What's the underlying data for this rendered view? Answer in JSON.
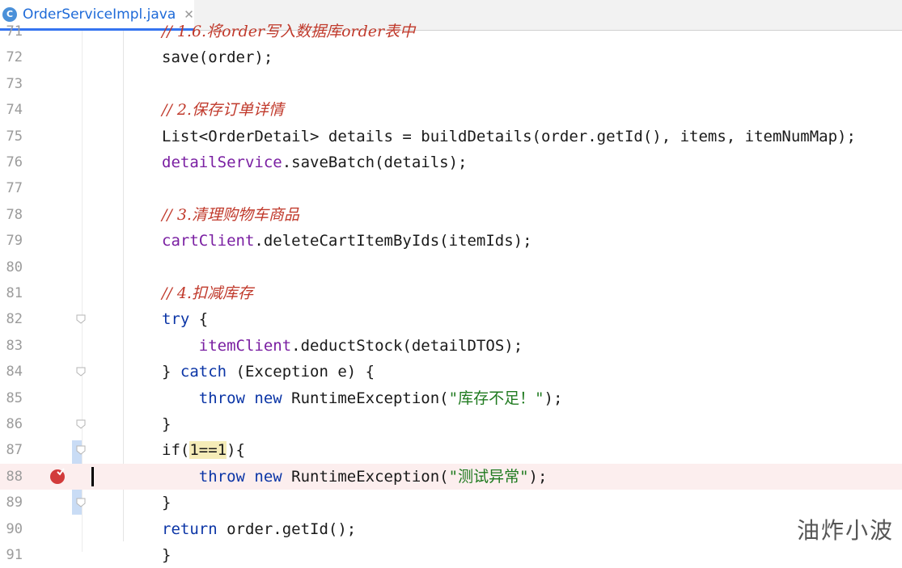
{
  "tab": {
    "icon_letter": "C",
    "title": "OrderServiceImpl.java",
    "close": "✕"
  },
  "lines": [
    {
      "num": "71",
      "parts": [
        {
          "t": "// 1.6.将order写入数据库order表中",
          "c": "cmt-red"
        }
      ]
    },
    {
      "num": "72",
      "parts": [
        {
          "t": "save(order);",
          "c": ""
        }
      ]
    },
    {
      "num": "73",
      "parts": []
    },
    {
      "num": "74",
      "parts": [
        {
          "t": "// 2.保存订单详情",
          "c": "cmt-red"
        }
      ]
    },
    {
      "num": "75",
      "parts": [
        {
          "t": "List<OrderDetail> details = buildDetails(order.getId(), items, itemNumMap);",
          "c": ""
        }
      ]
    },
    {
      "num": "76",
      "parts": [
        {
          "t": "detailService",
          "c": "fld"
        },
        {
          "t": ".saveBatch(details);",
          "c": ""
        }
      ]
    },
    {
      "num": "77",
      "parts": []
    },
    {
      "num": "78",
      "parts": [
        {
          "t": "// 3.清理购物车商品",
          "c": "cmt-red"
        }
      ]
    },
    {
      "num": "79",
      "parts": [
        {
          "t": "cartClient",
          "c": "fld"
        },
        {
          "t": ".deleteCartItemByIds(itemIds);",
          "c": ""
        }
      ]
    },
    {
      "num": "80",
      "parts": []
    },
    {
      "num": "81",
      "parts": [
        {
          "t": "// 4.扣减库存",
          "c": "cmt-red"
        }
      ]
    },
    {
      "num": "82",
      "parts": [
        {
          "t": "try",
          "c": "kw"
        },
        {
          "t": " {",
          "c": ""
        }
      ]
    },
    {
      "num": "83",
      "parts": [
        {
          "t": "    ",
          "c": ""
        },
        {
          "t": "itemClient",
          "c": "fld"
        },
        {
          "t": ".deductStock(detailDTOS);",
          "c": ""
        }
      ]
    },
    {
      "num": "84",
      "parts": [
        {
          "t": "} ",
          "c": ""
        },
        {
          "t": "catch",
          "c": "kw"
        },
        {
          "t": " (Exception e) {",
          "c": ""
        }
      ]
    },
    {
      "num": "85",
      "parts": [
        {
          "t": "    ",
          "c": ""
        },
        {
          "t": "throw new",
          "c": "kw"
        },
        {
          "t": " RuntimeException(",
          "c": ""
        },
        {
          "t": "\"库存不足！\"",
          "c": "str"
        },
        {
          "t": ");",
          "c": ""
        }
      ]
    },
    {
      "num": "86",
      "parts": [
        {
          "t": "}",
          "c": ""
        }
      ]
    },
    {
      "num": "87",
      "parts": [
        {
          "t": "if(",
          "c": ""
        },
        {
          "t": "1==1",
          "c": "hl"
        },
        {
          "t": "){",
          "c": ""
        }
      ]
    },
    {
      "num": "88",
      "parts": [
        {
          "t": "    ",
          "c": ""
        },
        {
          "t": "throw new",
          "c": "kw"
        },
        {
          "t": " RuntimeException(",
          "c": ""
        },
        {
          "t": "\"测试异常\"",
          "c": "str"
        },
        {
          "t": ");",
          "c": ""
        }
      ]
    },
    {
      "num": "89",
      "parts": [
        {
          "t": "}",
          "c": ""
        }
      ]
    },
    {
      "num": "90",
      "parts": [
        {
          "t": "return",
          "c": "kw"
        },
        {
          "t": " order.getId();",
          "c": ""
        }
      ]
    },
    {
      "num": "91",
      "parts": [
        {
          "t": "}",
          "c": ""
        }
      ]
    }
  ],
  "current_line": "88",
  "breakpoint_line": "88",
  "watermark": "油炸小波",
  "colors": {
    "keyword": "#0b35a6",
    "field": "#7a1fa2",
    "comment": "#c0392b",
    "string": "#1f7a1f",
    "current_line_bg": "#fceeee",
    "tab_accent": "#3574f0"
  }
}
